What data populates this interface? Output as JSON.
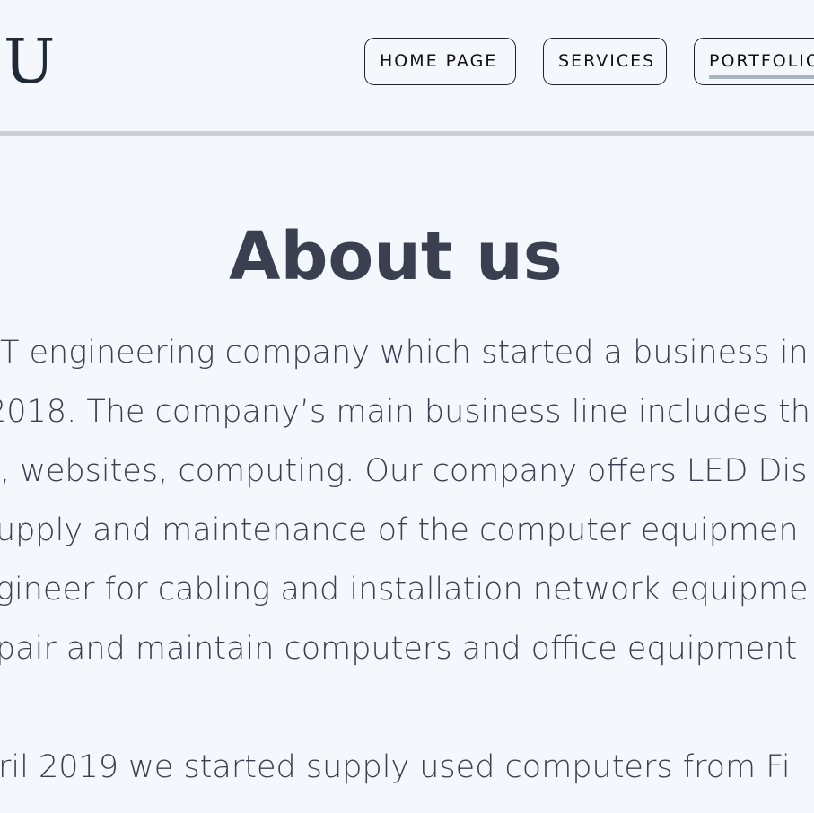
{
  "logo": {
    "text": "U"
  },
  "nav": {
    "items": [
      {
        "label": "HOME PAGE"
      },
      {
        "label": "SERVICES"
      },
      {
        "label": "PORTFOLIO"
      }
    ]
  },
  "main": {
    "title": "About us",
    "paragraphs": [
      {
        "lines": [
          "T engineering company which started a business in",
          "2018. The company’s main business line includes th",
          ", websites, computing. Our company offers LED Dis",
          "upply and maintenance of the computer equipmen",
          "gineer for cabling and installation network equipme",
          "pair and maintain computers and office equipment"
        ]
      },
      {
        "lines": [
          "ril 2019 we started supply used computers from Fi"
        ]
      }
    ]
  }
}
